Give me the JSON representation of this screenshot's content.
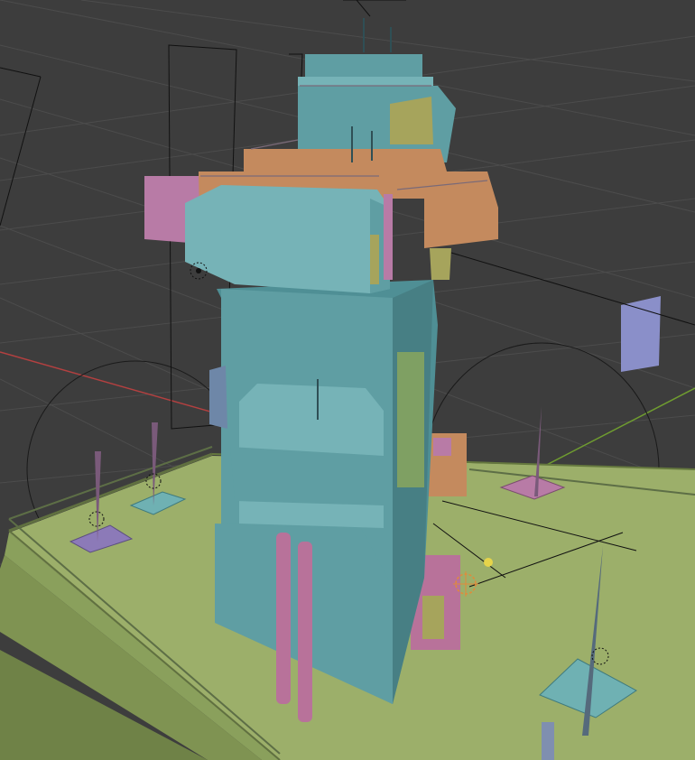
{
  "viewport": {
    "background": "#3d3d3d",
    "grid_color": "#4a4a4a",
    "axis_x_color": "#b34040",
    "axis_y_color": "#7aa832"
  },
  "materials": {
    "tower": "#5f9ea3",
    "tower_light": "#76b3b7",
    "tower_dark": "#4a7f85",
    "ground": "#9caf6a",
    "ground_dark": "#7f9352",
    "trim_orange": "#c48a5e",
    "accent_pink": "#b87ba6",
    "accent_purple": "#8c7ab8",
    "accent_lavender": "#8a8fc9",
    "accent_olive": "#a6a45c"
  },
  "icons": {
    "light": "point-light-icon",
    "camera": "camera-icon",
    "sun": "sun-light-icon"
  }
}
